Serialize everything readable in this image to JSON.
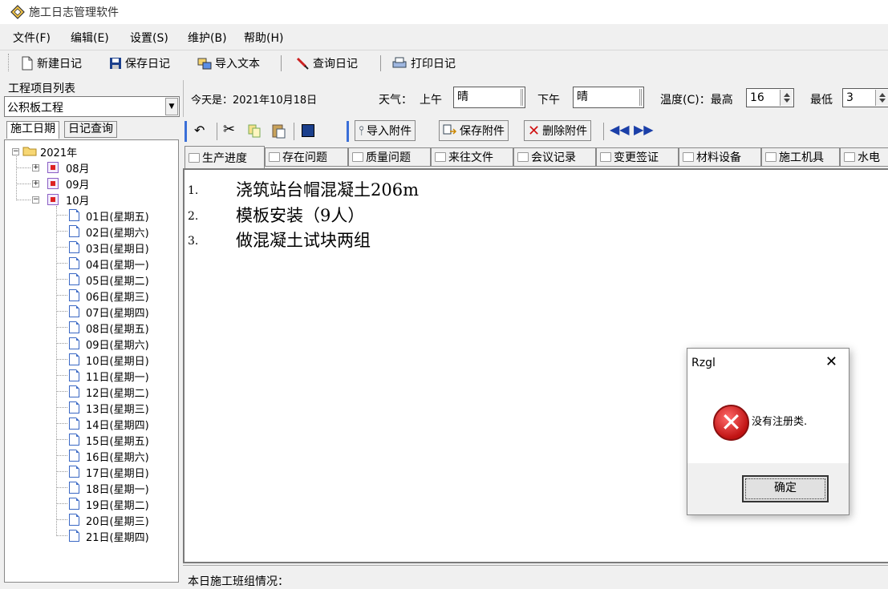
{
  "window": {
    "title": "施工日志管理软件"
  },
  "menu": [
    "文件(F)",
    "编辑(E)",
    "设置(S)",
    "维护(B)",
    "帮助(H)"
  ],
  "toolbar": {
    "new": "新建日记",
    "save": "保存日记",
    "import": "导入文本",
    "query": "查询日记",
    "print": "打印日记"
  },
  "left": {
    "title": "工程项目列表",
    "project": "公积板工程",
    "tabs": [
      "施工日期",
      "日记查询"
    ],
    "tree": {
      "year": "2021年",
      "months": [
        "08月",
        "09月",
        "10月"
      ],
      "days": [
        "01日(星期五)",
        "02日(星期六)",
        "03日(星期日)",
        "04日(星期一)",
        "05日(星期二)",
        "06日(星期三)",
        "07日(星期四)",
        "08日(星期五)",
        "09日(星期六)",
        "10日(星期日)",
        "11日(星期一)",
        "12日(星期二)",
        "13日(星期三)",
        "14日(星期四)",
        "15日(星期五)",
        "16日(星期六)",
        "17日(星期日)",
        "18日(星期一)",
        "19日(星期二)",
        "20日(星期三)",
        "21日(星期四)"
      ]
    }
  },
  "header": {
    "today_label": "今天是：2021年10月18日",
    "weather_label": "天气：",
    "am_label": "上午",
    "am_value": "晴",
    "pm_label": "下午",
    "pm_value": "晴",
    "temp_label": "温度(C)：最高",
    "temp_high": "16",
    "low_label": "最低",
    "temp_low": "3"
  },
  "editor_toolbar": {
    "import_attach": "导入附件",
    "save_attach": "保存附件",
    "delete_attach": "删除附件"
  },
  "tabs": [
    "生产进度",
    "存在问题",
    "质量问题",
    "来往文件",
    "会议记录",
    "变更签证",
    "材料设备",
    "施工机具",
    "水电"
  ],
  "content": {
    "lines": [
      {
        "num": "1.",
        "text": "浇筑站台帽混凝土206m"
      },
      {
        "num": "2.",
        "text": "模板安装（9人）"
      },
      {
        "num": "3.",
        "text": "做混凝土试块两组"
      }
    ]
  },
  "bottom_label": "本日施工班组情况：",
  "dialog": {
    "title": "Rzgl",
    "message": "没有注册类.",
    "ok": "确定"
  }
}
